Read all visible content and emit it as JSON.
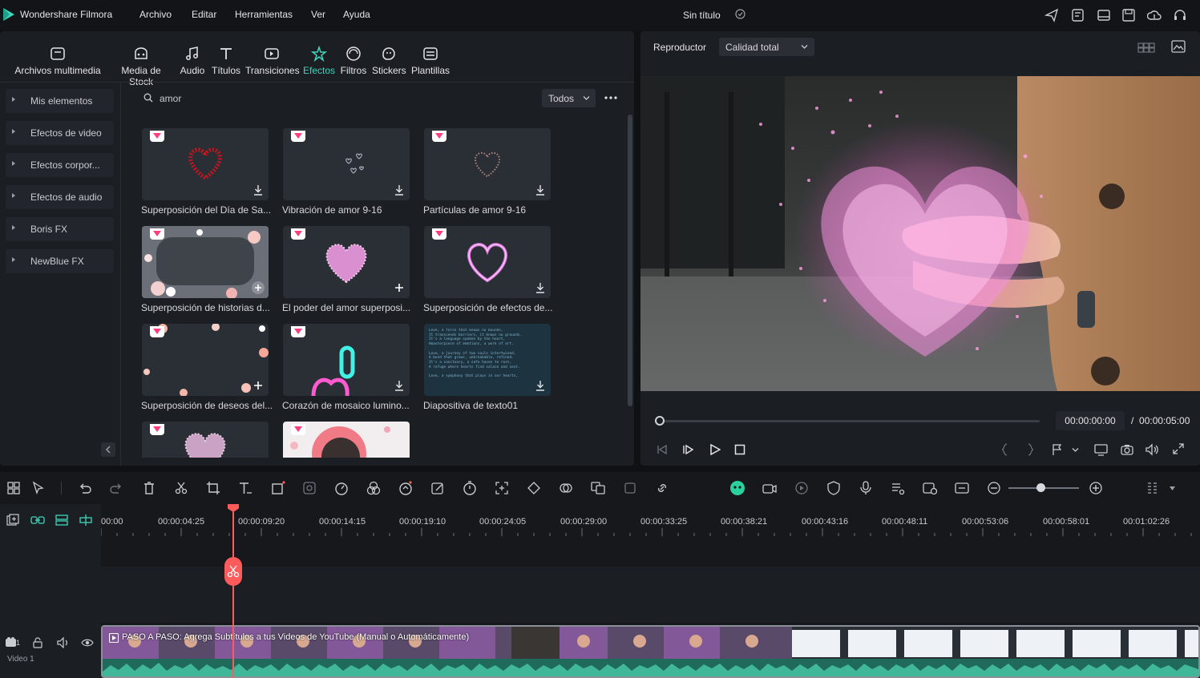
{
  "app": {
    "name": "Wondershare Filmora",
    "menu": [
      "Archivo",
      "Editar",
      "Herramientas",
      "Ver",
      "Ayuda"
    ],
    "project_title": "Sin título"
  },
  "library": {
    "tabs": [
      {
        "label": "Archivos multimedia",
        "icon": "media-icon"
      },
      {
        "label": "Media de Stock",
        "icon": "stock-icon"
      },
      {
        "label": "Audio",
        "icon": "music-note-icon"
      },
      {
        "label": "Títulos",
        "icon": "text-icon"
      },
      {
        "label": "Transiciones",
        "icon": "transition-icon"
      },
      {
        "label": "Efectos",
        "icon": "effects-icon",
        "active": true
      },
      {
        "label": "Filtros",
        "icon": "filter-icon"
      },
      {
        "label": "Stickers",
        "icon": "sticker-icon"
      },
      {
        "label": "Plantillas",
        "icon": "template-icon"
      }
    ],
    "sidebar": [
      "Mis elementos",
      "Efectos de video",
      "Efectos corpor...",
      "Efectos de audio",
      "Boris FX",
      "NewBlue FX"
    ],
    "search": {
      "value": "amor"
    },
    "filter": {
      "selected": "Todos"
    },
    "effects": [
      {
        "label": "Superposición del Día de Sa...",
        "action": "download"
      },
      {
        "label": "Vibración de amor 9-16",
        "action": "download"
      },
      {
        "label": "Partículas de amor 9-16",
        "action": "download"
      },
      {
        "label": "Superposición de historias d...",
        "action": "add"
      },
      {
        "label": "El poder del amor superposi...",
        "action": "add"
      },
      {
        "label": "Superposición de efectos de...",
        "action": "download"
      },
      {
        "label": "Superposición de deseos del...",
        "action": "add"
      },
      {
        "label": "Corazón de mosaico lumino...",
        "action": "download"
      },
      {
        "label": "Diapositiva de texto01",
        "action": "download"
      },
      {
        "label": "",
        "action": ""
      },
      {
        "label": "",
        "action": ""
      }
    ],
    "slide_text": [
      "Love, a force that knows no bounds,",
      "It transcends barriers, it knows no grounds.",
      "It's a language spoken by the heart,",
      "Amasterpiece of emotions, a work of art.",
      "",
      "Love, a journey of two souls intertwined,",
      "A bond that grows, unbreakable, refined.",
      "It's a sanctuary, a safe haven to rest,",
      "A refuge where hearts find solace and zest.",
      "",
      "Love, a symphony that plays in our hearts,"
    ]
  },
  "player": {
    "label": "Reproductor",
    "quality": "Calidad total",
    "current_time": "00:00:00:00",
    "separator": "/",
    "duration": "00:00:05:00",
    "progress": 0
  },
  "timeline": {
    "ticks": [
      "00:00",
      "00:00:04:25",
      "00:00:09:20",
      "00:00:14:15",
      "00:00:19:10",
      "00:00:24:05",
      "00:00:29:00",
      "00:00:33:25",
      "00:00:38:21",
      "00:00:43:16",
      "00:00:48:11",
      "00:00:53:06",
      "00:00:58:01",
      "00:01:02:26"
    ],
    "track_name": "Video 1",
    "track_number": "1",
    "clip_title": "PASO A PASO: Agrega Subtítulos a tus Videos de YouTube (Manual o Automáticamente)"
  },
  "colors": {
    "accent": "#3fd6bd",
    "playhead": "#ff5b5b",
    "panel": "#1b1e23",
    "background": "#0f1115"
  }
}
